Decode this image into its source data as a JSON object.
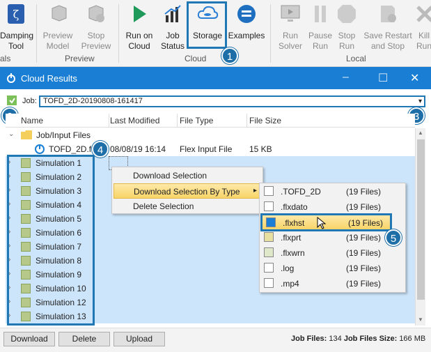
{
  "ribbon": {
    "buttons": [
      {
        "label": "Damping\nTool",
        "enabled": true
      },
      {
        "label": "Preview\nModel",
        "enabled": false
      },
      {
        "label": "Stop\nPreview",
        "enabled": false
      },
      {
        "label": "Run on\nCloud",
        "enabled": true
      },
      {
        "label": "Job\nStatus",
        "enabled": true
      },
      {
        "label": "Storage",
        "enabled": true
      },
      {
        "label": "Examples",
        "enabled": true
      },
      {
        "label": "Run\nSolver",
        "enabled": false
      },
      {
        "label": "Pause\nRun",
        "enabled": false
      },
      {
        "label": "Stop\nRun",
        "enabled": false
      },
      {
        "label": "Save Restart\nand Stop",
        "enabled": false
      },
      {
        "label": "Kill\nRun",
        "enabled": false
      }
    ],
    "groups": [
      "als",
      "Preview",
      "Cloud",
      "Local"
    ]
  },
  "window": {
    "title": "Cloud Results",
    "minimize": "–",
    "maximize": "☐",
    "close": "✕"
  },
  "job": {
    "label": "Job:",
    "value": "TOFD_2D-20190808-161417",
    "dropdown_glyph": "▾"
  },
  "columns": [
    "Name",
    "Last Modified",
    "File Type",
    "File Size"
  ],
  "tree": {
    "job_input_folder": "Job/Input Files",
    "input_file": {
      "name": "TOFD_2D.f",
      "modified": "08/08/19 16:14",
      "type": "Flex Input File",
      "size": "15 KB"
    },
    "simulations": [
      "Simulation 1",
      "Simulation 2",
      "Simulation 3",
      "Simulation 4",
      "Simulation 5",
      "Simulation 6",
      "Simulation 7",
      "Simulation 8",
      "Simulation 9",
      "Simulation 10",
      "Simulation 12",
      "Simulation 13"
    ]
  },
  "context_menu": {
    "items": [
      "Download Selection",
      "Download Selection By Type",
      "Delete Selection"
    ],
    "submenu_arrow": "▸"
  },
  "submenu": [
    {
      "ext": ".TOFD_2D",
      "count": "(19 Files)"
    },
    {
      "ext": ".flxdato",
      "count": "(19 Files)"
    },
    {
      "ext": ".flxhst",
      "count": "(19 Files)"
    },
    {
      "ext": ".flxprt",
      "count": "(19 Files)"
    },
    {
      "ext": ".flxwrn",
      "count": "(19 Files)"
    },
    {
      "ext": ".log",
      "count": "(19 Files)"
    },
    {
      "ext": ".mp4",
      "count": "(19 Files)"
    }
  ],
  "badges": [
    "1",
    "2",
    "3",
    "4",
    "5"
  ],
  "bottom": {
    "buttons": [
      "Download",
      "Delete",
      "Upload"
    ],
    "job_files_label": "Job Files:",
    "job_files_value": "134",
    "size_label": "Job Files Size:",
    "size_value": "166 MB"
  },
  "colors": {
    "accent": "#1a7fd4",
    "annotation": "#1e6fa8",
    "selection": "#cde5fb",
    "hover": "#f8d468"
  }
}
